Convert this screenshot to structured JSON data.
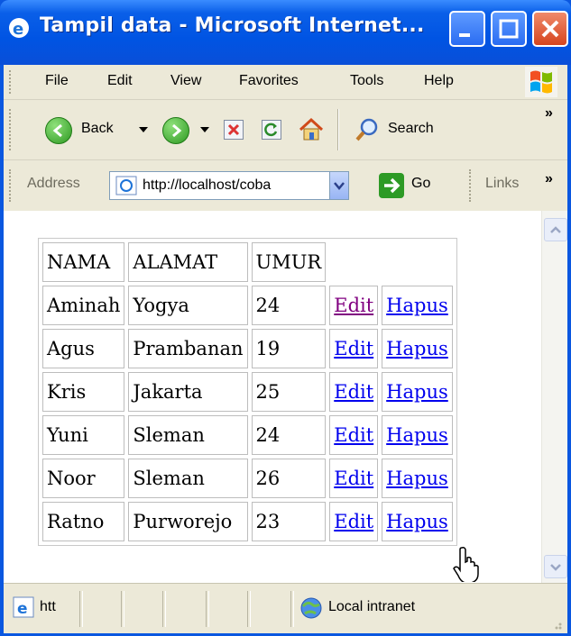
{
  "window": {
    "title": "Tampil data - Microsoft Internet..."
  },
  "menu": [
    "File",
    "Edit",
    "View",
    "Favorites",
    "Tools",
    "Help"
  ],
  "toolbar": {
    "back_label": "Back",
    "search_label": "Search",
    "more": "»"
  },
  "address": {
    "label": "Address",
    "url": "http://localhost/coba",
    "go_label": "Go",
    "links_label": "Links",
    "more": "»"
  },
  "table": {
    "headers": [
      "NAMA",
      "ALAMAT",
      "UMUR"
    ],
    "rows": [
      {
        "nama": "Aminah",
        "alamat": "Yogya",
        "umur": "24"
      },
      {
        "nama": "Agus",
        "alamat": "Prambanan",
        "umur": "19"
      },
      {
        "nama": "Kris",
        "alamat": "Jakarta",
        "umur": "25"
      },
      {
        "nama": "Yuni",
        "alamat": "Sleman",
        "umur": "24"
      },
      {
        "nama": "Noor",
        "alamat": "Sleman",
        "umur": "26"
      },
      {
        "nama": "Ratno",
        "alamat": "Purworejo",
        "umur": "23"
      }
    ],
    "edit_label": "Edit",
    "hapus_label": "Hapus"
  },
  "status": {
    "left": "htt",
    "zone": "Local intranet"
  },
  "colors": {
    "title_bar": "#0054e3",
    "chrome": "#ece9d8",
    "link": "#0000ee",
    "visited_link": "#800080"
  }
}
